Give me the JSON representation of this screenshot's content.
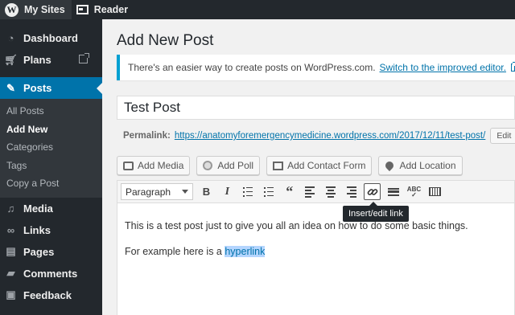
{
  "topbar": {
    "my_sites": "My Sites",
    "reader": "Reader"
  },
  "sidebar": {
    "items": [
      {
        "label": "Dashboard",
        "icon": "dashboard-icon"
      },
      {
        "label": "Plans",
        "icon": "cart-icon"
      },
      {
        "label": "Posts",
        "icon": "pin-icon"
      },
      {
        "label": "Media",
        "icon": "media-icon"
      },
      {
        "label": "Links",
        "icon": "link-icon"
      },
      {
        "label": "Pages",
        "icon": "pages-icon"
      },
      {
        "label": "Comments",
        "icon": "comment-icon"
      },
      {
        "label": "Feedback",
        "icon": "feedback-icon"
      }
    ],
    "posts_submenu": [
      "All Posts",
      "Add New",
      "Categories",
      "Tags",
      "Copy a Post"
    ]
  },
  "page": {
    "title": "Add New Post",
    "notice_text": "There's an easier way to create posts on WordPress.com.",
    "notice_link": "Switch to the improved editor.",
    "post_title": "Test Post",
    "permalink_label": "Permalink:",
    "permalink_url": "https://anatomyforemergencymedicine.wordpress.com/2017/12/11/test-post/",
    "edit_label": "Edit"
  },
  "media_buttons": {
    "add_media": "Add Media",
    "add_poll": "Add Poll",
    "add_contact_form": "Add Contact Form",
    "add_location": "Add Location"
  },
  "editor": {
    "format_select": "Paragraph",
    "tooltip": "Insert/edit link",
    "paragraph_1": "This is a test post just to give you all an idea on how to do some basic things.",
    "paragraph_2_prefix": "For example here is a ",
    "paragraph_2_link": "hyperlink"
  },
  "colors": {
    "admin_bar": "#23282d",
    "accent": "#0073aa",
    "notice_border": "#00a0d2",
    "selection": "#b4d5fe"
  }
}
